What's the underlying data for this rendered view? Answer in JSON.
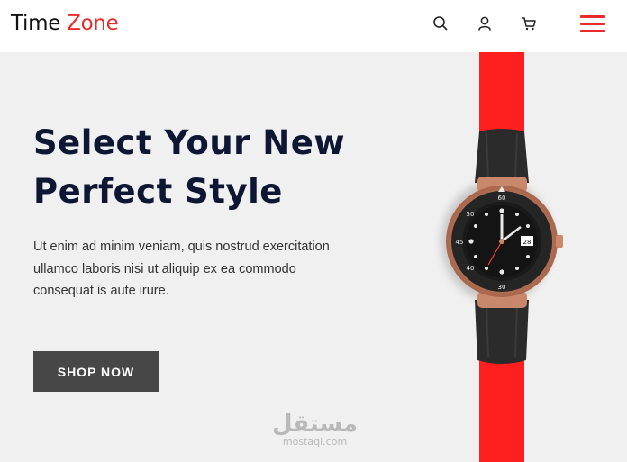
{
  "header": {
    "logo_part1": "Time",
    "logo_part2": "Zone",
    "icons": [
      "search-icon",
      "user-icon",
      "cart-icon",
      "hamburger-menu-icon"
    ]
  },
  "hero": {
    "title_line1": "Select Your New",
    "title_line2": "Perfect Style",
    "description": "Ut enim ad minim veniam, quis nostrud exercitation ullamco laboris nisi ut aliquip ex ea commodo consequat is aute irure.",
    "button_label": "SHOP NOW"
  },
  "watermark": {
    "arabic": "مستقل",
    "latin": "mostaql.com"
  },
  "colors": {
    "accent": "#ea2b2b",
    "strap": "#ff1f1f",
    "hero_bg": "#f0f0f1",
    "title": "#0d1633",
    "button_bg": "#474747"
  }
}
